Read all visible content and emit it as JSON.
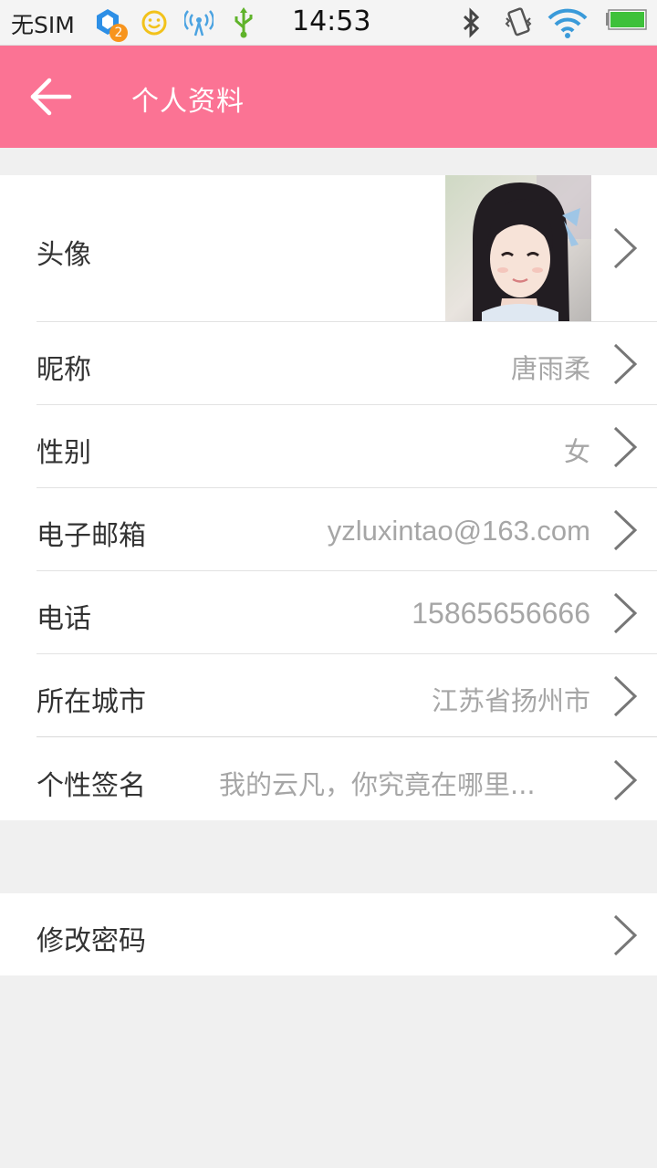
{
  "status_bar": {
    "carrier": "无SIM",
    "notification_count": "2",
    "time": "14:53",
    "icons": [
      "qq-icon",
      "smiley-icon",
      "wifi-hotspot-icon",
      "usb-icon",
      "bluetooth-icon",
      "vibrate-icon",
      "wifi-icon",
      "battery-icon"
    ]
  },
  "header": {
    "title": "个人资料",
    "back_icon": "arrow-left-icon",
    "background": "#fb7394"
  },
  "profile": {
    "avatar_label": "头像",
    "nickname_label": "昵称",
    "nickname": "唐雨柔",
    "gender_label": "性别",
    "gender": "女",
    "email_label": "电子邮箱",
    "email": "yzluxintao@163.com",
    "phone_label": "电话",
    "phone": "15865656666",
    "city_label": "所在城市",
    "city": "江苏省扬州市",
    "signature_label": "个性签名",
    "signature": "我的云凡，你究竟在哪里..."
  },
  "security": {
    "change_password_label": "修改密码"
  }
}
